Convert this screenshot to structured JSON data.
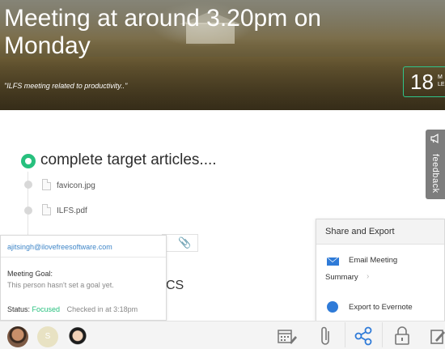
{
  "hero": {
    "title": "Meeting at around 3.20pm on Monday",
    "quote": "\"ILFS meeting related to productivity..\"",
    "count": "18",
    "count_unit_line1": "M",
    "count_unit_line2": "LE"
  },
  "feedback": {
    "label": "feedback"
  },
  "goal": {
    "title": "complete target articles....",
    "attachments": [
      {
        "name": "favicon.jpg"
      },
      {
        "name": "ILFS.pdf"
      }
    ],
    "partial_text": "CS"
  },
  "user_popup": {
    "email": "ajitsingh@ilovefreesoftware.com",
    "goal_label": "Meeting Goal:",
    "goal_text": "This person hasn't set a goal yet.",
    "status_label": "Status:",
    "status_value": "Focused",
    "checked_in": "Checked in at 3:18pm"
  },
  "share_panel": {
    "title": "Share and Export",
    "email_label": "Email Meeting",
    "summary_label": "Summary",
    "evernote_label": "Export to Evernote"
  },
  "toolbar": {
    "avatar_initial": "S"
  },
  "colors": {
    "accent_green": "#27c07e",
    "link_blue": "#3f86c8",
    "icon_blue": "#2f7bd8"
  }
}
